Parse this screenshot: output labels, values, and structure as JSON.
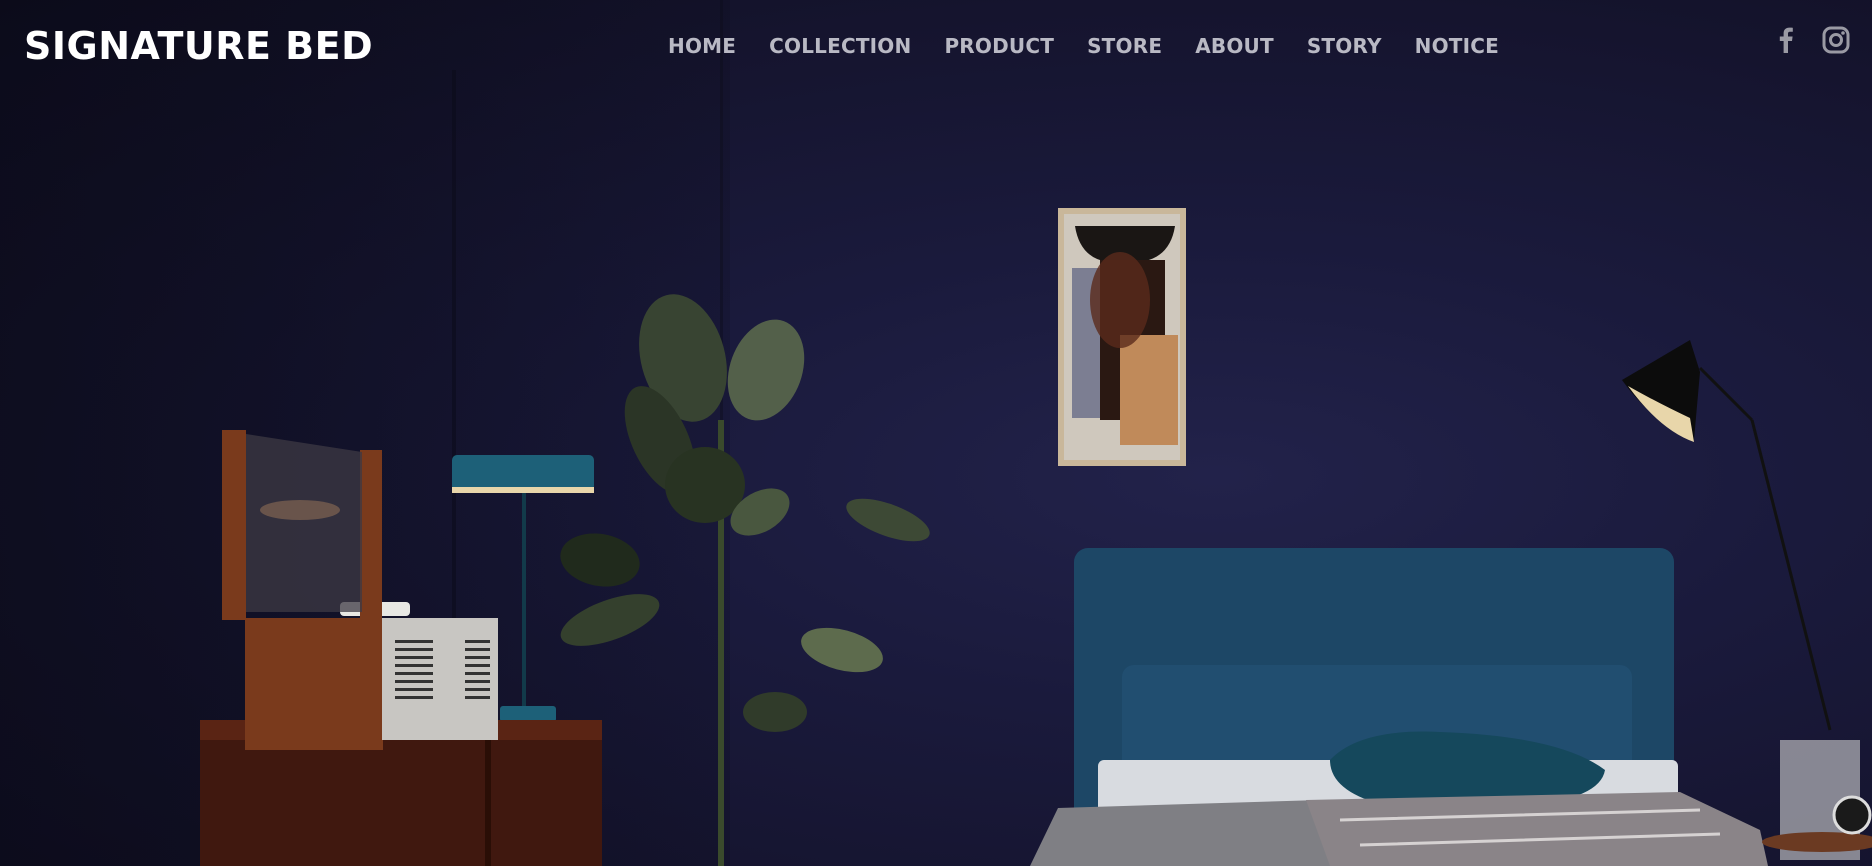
{
  "brand": {
    "logo": "SIGNATURE BED"
  },
  "nav": {
    "items": [
      {
        "label": "HOME"
      },
      {
        "label": "COLLECTION"
      },
      {
        "label": "PRODUCT"
      },
      {
        "label": "STORE"
      },
      {
        "label": "ABOUT"
      },
      {
        "label": "STORY"
      },
      {
        "label": "NOTICE"
      }
    ]
  },
  "social": {
    "icons": [
      "facebook-icon",
      "instagram-icon"
    ]
  },
  "colors": {
    "background": "#1a1a3c",
    "headboard": "#1d4766",
    "nav_text": "#b9b9c4",
    "logo": "#ffffff"
  }
}
